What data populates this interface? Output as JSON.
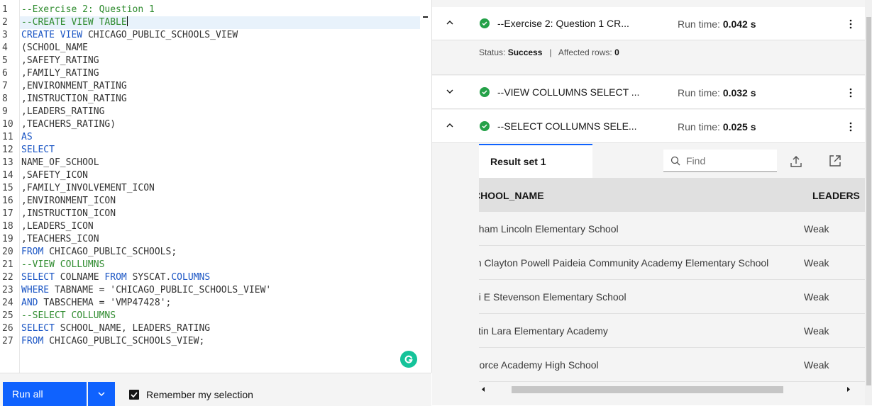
{
  "editor": {
    "line_numbers": [
      "1",
      "2",
      "3",
      "4",
      "5",
      "6",
      "7",
      "8",
      "9",
      "10",
      "11",
      "12",
      "13",
      "14",
      "15",
      "16",
      "17",
      "18",
      "19",
      "20",
      "21",
      "22",
      "23",
      "24",
      "25",
      "26",
      "27"
    ],
    "lines": [
      "--Exercise 2: Question 1",
      "--CREATE VIEW TABLE",
      "CREATE VIEW CHICAGO_PUBLIC_SCHOOLS_VIEW",
      "(SCHOOL_NAME",
      ",SAFETY_RATING",
      ",FAMILY_RATING",
      ",ENVIRONMENT_RATING",
      ",INSTRUCTION_RATING",
      ",LEADERS_RATING",
      ",TEACHERS_RATING)",
      "AS",
      "SELECT",
      "NAME_OF_SCHOOL",
      ",SAFETY_ICON",
      ",FAMILY_INVOLVEMENT_ICON",
      ",ENVIRONMENT_ICON",
      ",INSTRUCTION_ICON",
      ",LEADERS_ICON",
      ",TEACHERS_ICON",
      "FROM CHICAGO_PUBLIC_SCHOOLS;",
      "--VIEW COLLUMNS",
      "SELECT COLNAME FROM SYSCAT.COLUMNS",
      "WHERE TABNAME = 'CHICAGO_PUBLIC_SCHOOLS_VIEW'",
      "AND TABSCHEMA = 'VMP47428';",
      "--SELECT COLLUMNS",
      "SELECT SCHOOL_NAME, LEADERS_RATING",
      "FROM CHICAGO_PUBLIC_SCHOOLS_VIEW;"
    ]
  },
  "bottom": {
    "run_label": "Run all",
    "remember_label": "Remember my selection",
    "remember_checked": true
  },
  "queries": [
    {
      "title": "--Exercise 2: Question 1 CR...",
      "run_time_label": "Run time:",
      "run_time": "0.042 s",
      "expanded": true
    },
    {
      "title": "--VIEW COLLUMNS SELECT ...",
      "run_time_label": "Run time:",
      "run_time": "0.032 s",
      "expanded": false
    },
    {
      "title": "--SELECT COLLUMNS SELE...",
      "run_time_label": "Run time:",
      "run_time": "0.025 s",
      "expanded": true
    }
  ],
  "status": {
    "status_label": "Status:",
    "status_value": "Success",
    "separator": "|",
    "affected_label": "Affected rows:",
    "affected_value": "0"
  },
  "result": {
    "tab_label": "Result set 1",
    "find_placeholder": "Find",
    "columns": [
      "CHOOL_NAME",
      "LEADERS"
    ],
    "rows": [
      [
        "aham Lincoln Elementary School",
        "Weak"
      ],
      [
        "m Clayton Powell Paideia Community Academy Elementary School",
        "Weak"
      ],
      [
        "ai E Stevenson Elementary School",
        "Weak"
      ],
      [
        "stin Lara Elementary Academy",
        "Weak"
      ],
      "Force Academy High School|Weak"
    ]
  },
  "colors": {
    "accent": "#0f62fe",
    "success": "#24a148",
    "comment": "#2e8b2e",
    "keyword": "#1a55c4"
  },
  "icons": [
    "chevron-up-icon",
    "chevron-down-icon",
    "checkmark-circle-icon",
    "overflow-menu-icon",
    "search-icon",
    "upload-icon",
    "launch-icon",
    "grammarly-icon"
  ]
}
